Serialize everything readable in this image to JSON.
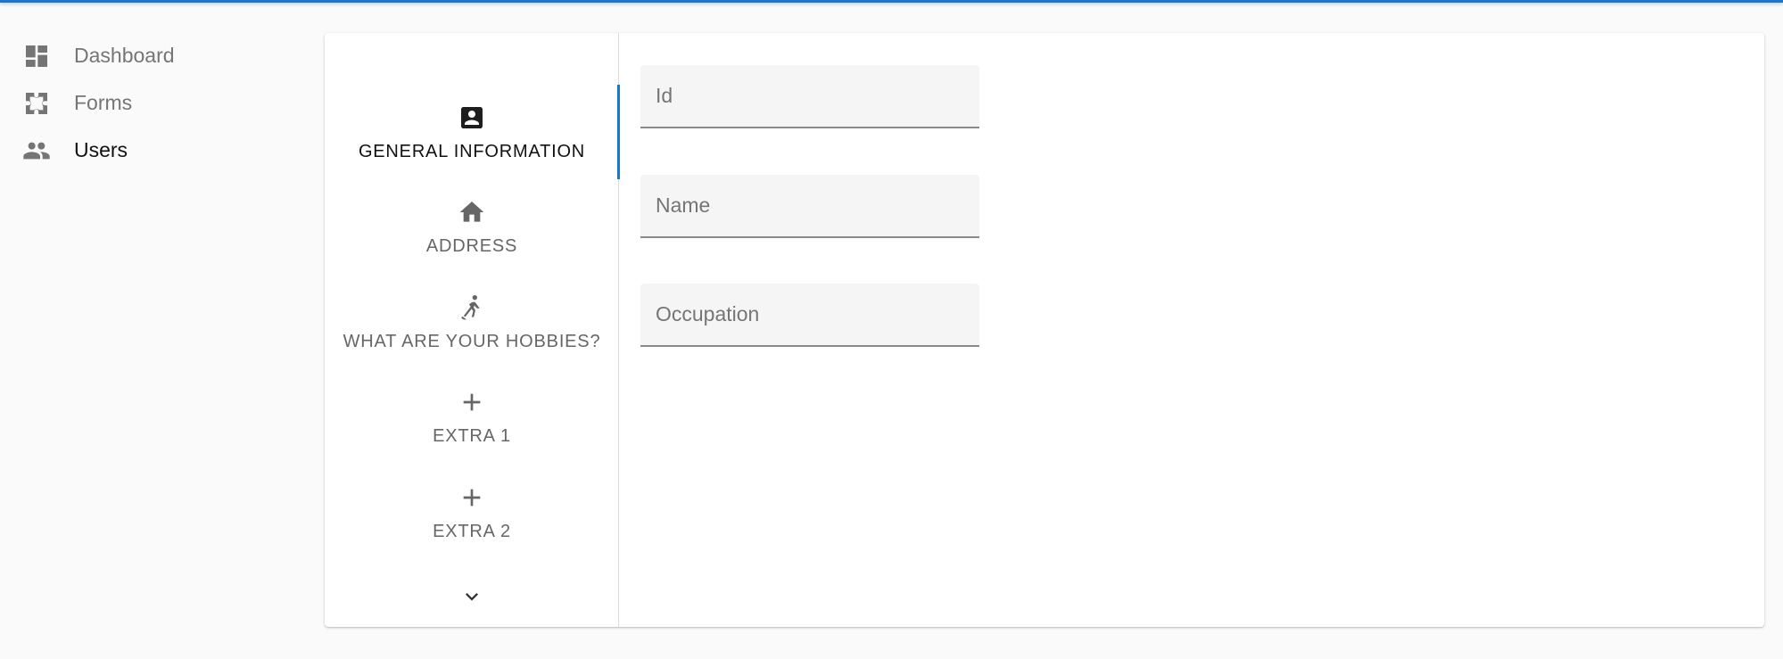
{
  "colors": {
    "accent": "#1976d2",
    "icon_gray": "#757575",
    "panel_bg": "#ffffff",
    "page_bg": "#fafafa",
    "field_bg": "#f5f5f5"
  },
  "sidebar": {
    "items": [
      {
        "label": "Dashboard",
        "icon": "dashboard-icon",
        "active": false
      },
      {
        "label": "Forms",
        "icon": "extension-icon",
        "active": false
      },
      {
        "label": "Users",
        "icon": "people-icon",
        "active": true
      }
    ]
  },
  "tabs": {
    "items": [
      {
        "label": "GENERAL INFORMATION",
        "icon": "account-box-icon",
        "active": true
      },
      {
        "label": "ADDRESS",
        "icon": "home-icon",
        "active": false
      },
      {
        "label": "WHAT ARE YOUR HOBBIES?",
        "icon": "hockey-player-icon",
        "active": false
      },
      {
        "label": "EXTRA 1",
        "icon": "plus-icon",
        "active": false
      },
      {
        "label": "EXTRA 2",
        "icon": "plus-icon",
        "active": false
      }
    ],
    "scroll_icon": "chevron-down-icon"
  },
  "form": {
    "fields": [
      {
        "placeholder": "Id",
        "value": ""
      },
      {
        "placeholder": "Name",
        "value": ""
      },
      {
        "placeholder": "Occupation",
        "value": ""
      }
    ]
  }
}
